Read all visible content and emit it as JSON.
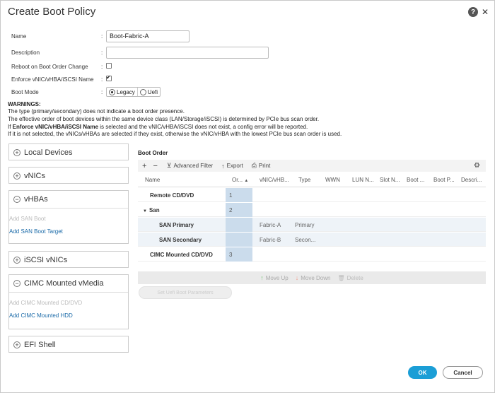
{
  "dialog": {
    "title": "Create Boot Policy",
    "help_icon": "?",
    "close_icon": "✕"
  },
  "form": {
    "name_label": "Name",
    "name_value": "Boot-Fabric-A",
    "description_label": "Description",
    "description_value": "",
    "reboot_label": "Reboot on Boot Order Change",
    "reboot_checked": false,
    "enforce_label": "Enforce vNIC/vHBA/iSCSI Name",
    "enforce_checked": true,
    "boot_mode_label": "Boot Mode",
    "boot_mode_options": [
      "Legacy",
      "Uefi"
    ],
    "boot_mode_selected": "Legacy",
    "colon": ":"
  },
  "warnings": {
    "title": "WARNINGS:",
    "line1": "The type (primary/secondary) does not indicate a boot order presence.",
    "line2": "The effective order of boot devices within the same device class (LAN/Storage/iSCSI) is determined by PCIe bus scan order.",
    "line3_pre": "If ",
    "line3_bold": "Enforce vNIC/vHBA/iSCSI Name",
    "line3_post": " is selected and the vNIC/vHBA/iSCSI does not exist, a config error will be reported.",
    "line4": "If it is not selected, the vNICs/vHBAs are selected if they exist, otherwise the vNIC/vHBA with the lowest PCIe bus scan order is used."
  },
  "left_panels": {
    "local_devices": "Local Devices",
    "local_devices_sign": "+",
    "vnics": "vNICs",
    "vnics_sign": "+",
    "vhbas": "vHBAs",
    "vhbas_sign": "−",
    "add_san_boot": "Add SAN Boot",
    "add_san_boot_target": "Add SAN Boot Target",
    "iscsi_vnics": "iSCSI vNICs",
    "iscsi_sign": "+",
    "cimc_vmedia": "CIMC Mounted vMedia",
    "cimc_sign": "−",
    "add_cimc_cd": "Add CIMC Mounted CD/DVD",
    "add_cimc_hdd": "Add CIMC Mounted HDD",
    "efi_shell": "EFI Shell",
    "efi_sign": "+"
  },
  "boot_order": {
    "title": "Boot Order",
    "toolbar": {
      "add": "+",
      "remove": "−",
      "filter_icon": "⊻",
      "advanced_filter": "Advanced Filter",
      "export_icon": "↑",
      "export": "Export",
      "print_icon": "⎙",
      "print": "Print",
      "gear_icon": "⚙"
    },
    "columns": [
      "Name",
      "Or...",
      "vNIC/vHB...",
      "Type",
      "WWN",
      "LUN N...",
      "Slot N...",
      "Boot ...",
      "Boot P...",
      "Descri..."
    ],
    "sort_indicator": "▲",
    "rows": [
      {
        "name": "Remote CD/DVD",
        "order": "1",
        "vnic": "",
        "type": ""
      },
      {
        "name": "San",
        "order": "2",
        "vnic": "",
        "type": "",
        "chevron": "▼"
      },
      {
        "name": "SAN Primary",
        "order": "",
        "vnic": "Fabric-A",
        "type": "Primary"
      },
      {
        "name": "SAN Secondary",
        "order": "",
        "vnic": "Fabric-B",
        "type": "Secon..."
      },
      {
        "name": "CIMC Mounted CD/DVD",
        "order": "3",
        "vnic": "",
        "type": ""
      }
    ],
    "actions": {
      "move_up_icon": "↑",
      "move_up": "Move Up",
      "move_down_icon": "↓",
      "move_down": "Move Down",
      "delete_icon": "🗑",
      "delete": "Delete"
    },
    "add_san_primary": "Set Uefi Boot Parameters"
  },
  "footer": {
    "ok": "OK",
    "cancel": "Cancel"
  },
  "colors": {
    "accent": "#1b9ed6",
    "link": "#1a6aa8",
    "order_cell": "#cbdcec",
    "move_up": "#7bc67b",
    "move_down": "#f0a090"
  }
}
